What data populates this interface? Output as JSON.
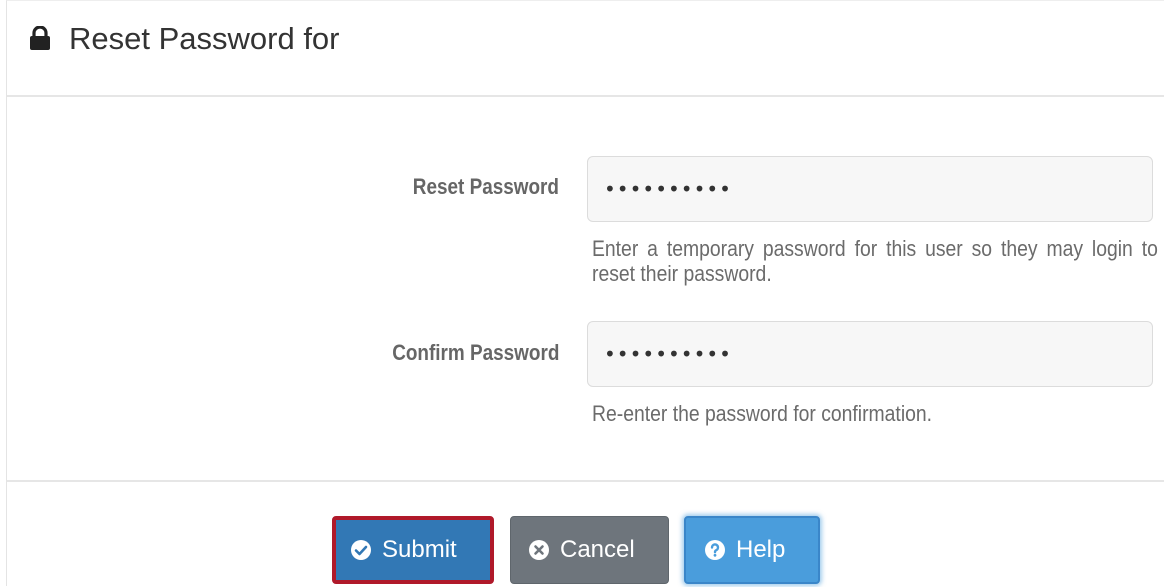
{
  "panel": {
    "title": "Reset Password for",
    "title_icon": "lock-icon"
  },
  "form": {
    "reset_password": {
      "label": "Reset Password",
      "value": "••••••••••",
      "help": "Enter a temporary password for this user so they may login to reset their password."
    },
    "confirm_password": {
      "label": "Confirm Password",
      "value": "••••••••••",
      "help": "Re-enter the password for confirmation."
    }
  },
  "buttons": {
    "submit": {
      "label": "Submit",
      "icon": "check-circle-icon",
      "color": "#3278b5",
      "highlight": "#b0192a"
    },
    "cancel": {
      "label": "Cancel",
      "icon": "times-circle-icon",
      "color": "#6e757c"
    },
    "help": {
      "label": "Help",
      "icon": "question-circle-icon",
      "color": "#4a9ddc"
    }
  }
}
